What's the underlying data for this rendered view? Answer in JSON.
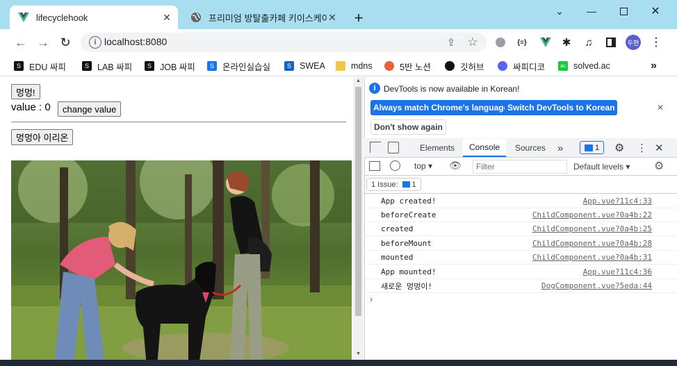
{
  "browser": {
    "tabs": [
      {
        "title": "lifecyclehook",
        "active": true
      },
      {
        "title": "프리미엄 방탈출카페 키이스케이",
        "active": false
      }
    ],
    "url": "localhost:8080",
    "profile_initials": "두현",
    "extension_label": "{≡}",
    "bookmarks": [
      {
        "label": "EDU 싸피",
        "icon": "ssafy-icon",
        "color": "#111111"
      },
      {
        "label": "LAB 싸피",
        "icon": "ssafy-icon",
        "color": "#111111"
      },
      {
        "label": "JOB 싸피",
        "icon": "ssafy-icon",
        "color": "#111111"
      },
      {
        "label": "온라인실습실",
        "icon": "ssafy-icon",
        "color": "#1a73e8"
      },
      {
        "label": "SWEA",
        "icon": "swea-icon",
        "color": "#1565c0"
      },
      {
        "label": "mdns",
        "icon": "folder-icon",
        "color": "#f4c542"
      },
      {
        "label": "5반 노션",
        "icon": "peach-icon",
        "color": "#e8603c"
      },
      {
        "label": "깃허브",
        "icon": "github-icon",
        "color": "#111111"
      },
      {
        "label": "싸피디코",
        "icon": "discord-icon",
        "color": "#5865f2"
      },
      {
        "label": "solved.ac",
        "icon": "solvedac-icon",
        "color": "#17ce3a"
      }
    ]
  },
  "page": {
    "bark_button": "멍멍!",
    "value_label": "value : 0",
    "change_value_button": "change value",
    "dog_button": "멍멍아 이리온"
  },
  "devtools": {
    "notice_text": "DevTools is now available in Korean!",
    "always_match_button": "Always match Chrome's language",
    "switch_button": "Switch DevTools to Korean",
    "dont_show_button": "Don't show again",
    "tabs": [
      "Elements",
      "Console",
      "Sources"
    ],
    "active_tab": "Console",
    "more_tabs": "»",
    "issue_badge_count": "1",
    "context": "top",
    "filter_placeholder": "Filter",
    "levels": "Default levels",
    "issues_label": "1 Issue:",
    "issues_count": "1",
    "logs": [
      {
        "message": "App created!",
        "source": "App.vue?11c4:33"
      },
      {
        "message": "beforeCreate",
        "source": "ChildComponent.vue?0a4b:22"
      },
      {
        "message": "created",
        "source": "ChildComponent.vue?0a4b:25"
      },
      {
        "message": "beforeMount",
        "source": "ChildComponent.vue?0a4b:28"
      },
      {
        "message": "mounted",
        "source": "ChildComponent.vue?0a4b:31"
      },
      {
        "message": "App mounted!",
        "source": "App.vue?11c4:36"
      },
      {
        "message": "새로운 멍멍이!",
        "source": "DogComponent.vue?5eda:44"
      }
    ],
    "prompt": "›"
  }
}
